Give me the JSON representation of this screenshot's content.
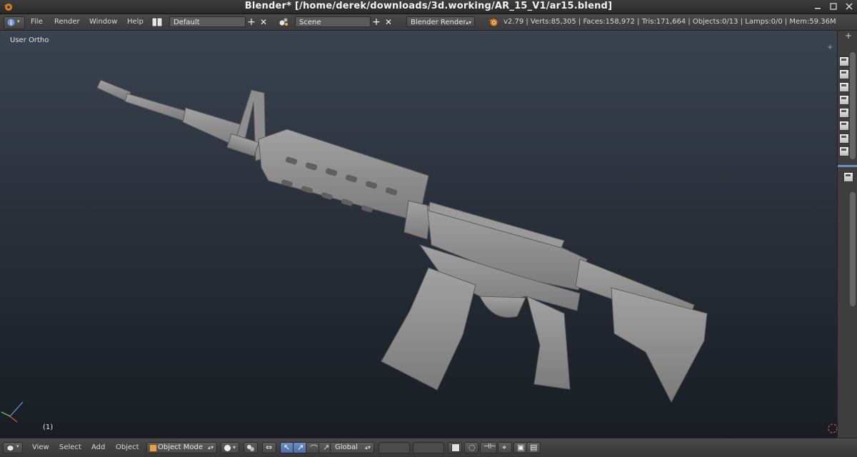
{
  "window": {
    "title": "Blender* [/home/derek/downloads/3d.working/AR_15_V1/ar15.blend]"
  },
  "info_header": {
    "menus": [
      "File",
      "Render",
      "Window",
      "Help"
    ],
    "screen_layout": "Default",
    "scene": "Scene",
    "render_engine": "Blender Render",
    "stats": "v2.79 | Verts:85,305 | Faces:158,972 | Tris:171,664 | Objects:0/13 | Lamps:0/0 | Mem:59.36M"
  },
  "viewport": {
    "view_label": "User Ortho",
    "frame_label": "(1)"
  },
  "view3d_header": {
    "menus": [
      "View",
      "Select",
      "Add",
      "Object"
    ],
    "mode": "Object Mode",
    "transform_orientation": "Global"
  },
  "colors": {
    "accent_blue": "#6b8fbf",
    "model_gray": "#8e8e8e",
    "blender_orange": "#e87d0d"
  },
  "icons": {
    "app_logo": "blender-logo-icon",
    "editor_type": "info-editor-icon",
    "add": "plus-icon",
    "remove": "close-icon",
    "view3d_editor": "cube-editor-icon",
    "viewport_shading": "solid-shading-icon"
  }
}
